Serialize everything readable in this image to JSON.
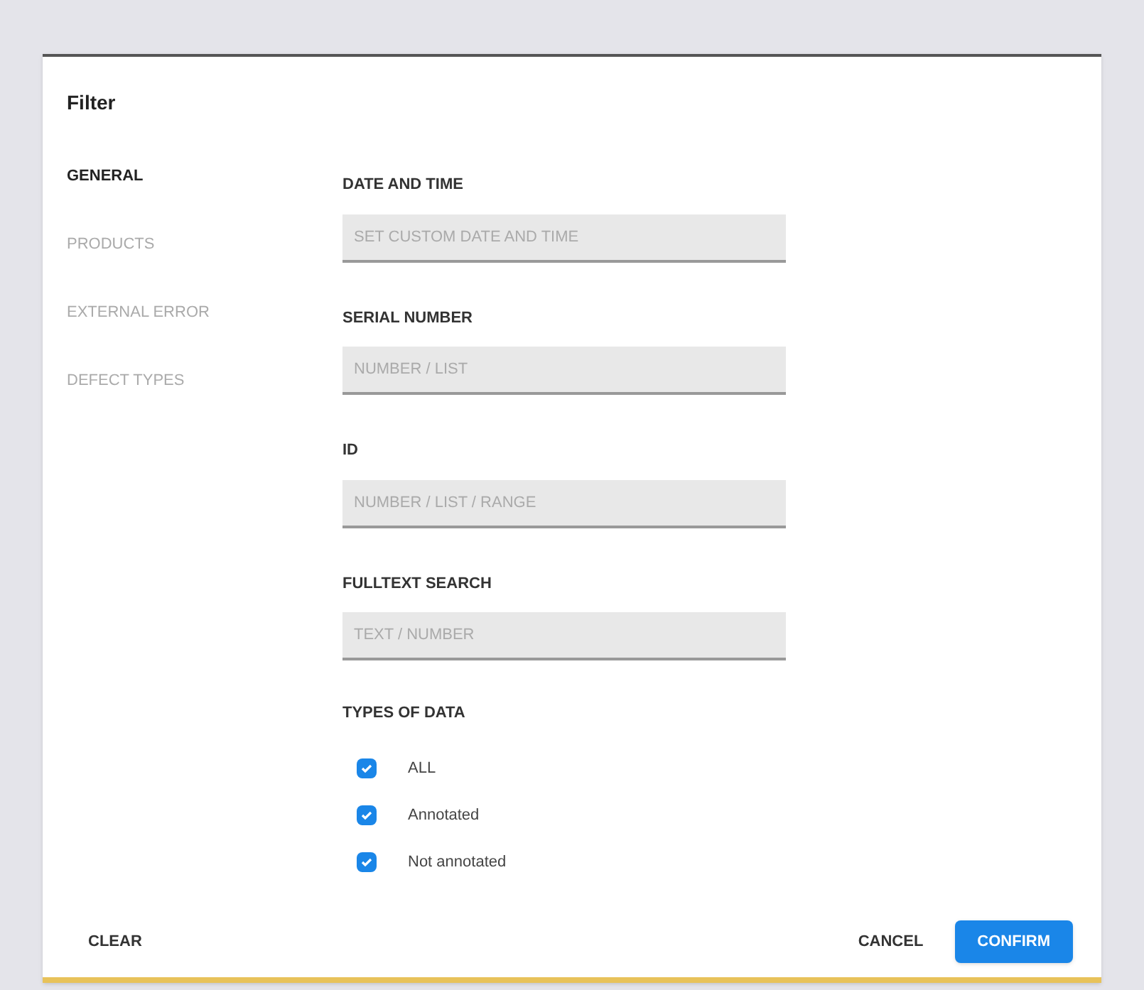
{
  "dialog": {
    "title": "Filter"
  },
  "sidebar": {
    "items": [
      {
        "label": "GENERAL",
        "selected": true
      },
      {
        "label": "PRODUCTS",
        "selected": false
      },
      {
        "label": "EXTERNAL ERROR",
        "selected": false
      },
      {
        "label": "DEFECT TYPES",
        "selected": false
      }
    ]
  },
  "fields": [
    {
      "label": "DATE AND TIME",
      "placeholder": "SET CUSTOM DATE AND TIME"
    },
    {
      "label": "SERIAL NUMBER",
      "placeholder": "NUMBER / LIST"
    },
    {
      "label": "ID",
      "placeholder": "NUMBER / LIST / RANGE"
    },
    {
      "label": "FULLTEXT SEARCH",
      "placeholder": "TEXT / NUMBER"
    }
  ],
  "types_of_data": {
    "label": "TYPES OF DATA",
    "options": [
      {
        "label": "ALL",
        "checked": true
      },
      {
        "label": "Annotated",
        "checked": true
      },
      {
        "label": "Not annotated",
        "checked": true
      }
    ]
  },
  "buttons": [
    {
      "label": "CLEAR",
      "kind": "text"
    },
    {
      "label": "CANCEL",
      "kind": "text"
    },
    {
      "label": "CONFIRM",
      "kind": "primary"
    }
  ]
}
